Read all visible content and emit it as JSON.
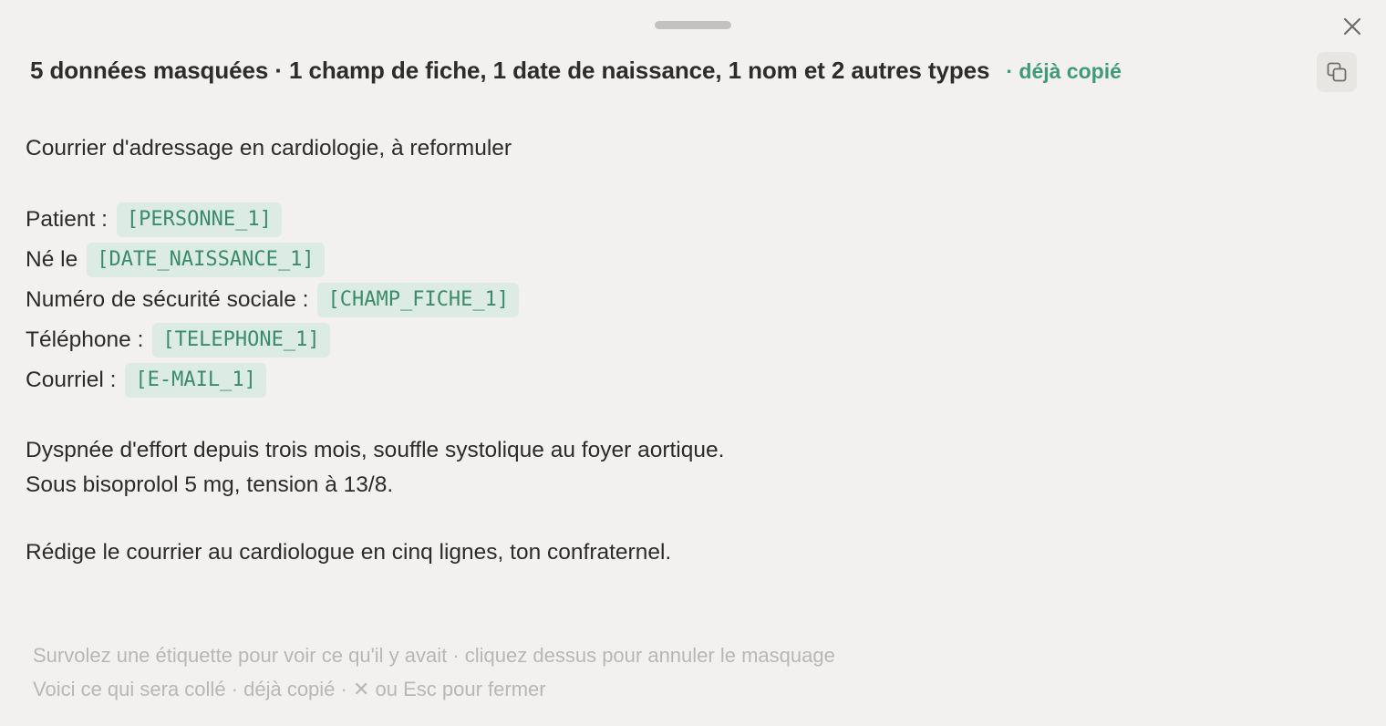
{
  "header": {
    "title": "5 données masquées · 1 champ de fiche, 1 date de naissance, 1 nom et 2 autres types",
    "status": "· déjà copié"
  },
  "icons": {
    "close": "close-icon",
    "copy": "copy-icon"
  },
  "colors": {
    "accent_green": "#3f9a78",
    "tag_background": "#dcece4",
    "background": "#f3f1ef"
  },
  "content": {
    "intro": "Courrier d'adressage en cardiologie, à reformuler",
    "fields": [
      {
        "label": "Patient :",
        "tag": "[PERSONNE_1]"
      },
      {
        "label": "Né le",
        "tag": "[DATE_NAISSANCE_1]"
      },
      {
        "label": "Numéro de sécurité sociale :",
        "tag": "[CHAMP_FICHE_1]"
      },
      {
        "label": "Téléphone :",
        "tag": "[TELEPHONE_1]"
      },
      {
        "label": "Courriel :",
        "tag": "[E-MAIL_1]"
      }
    ],
    "clinical_line_1": "Dyspnée d'effort depuis trois mois, souffle systolique au foyer aortique.",
    "clinical_line_2": "Sous bisoprolol 5 mg, tension à 13/8.",
    "instruction": "Rédige le courrier au cardiologue en cinq lignes, ton confraternel."
  },
  "footer": {
    "hint_1": "Survolez une étiquette pour voir ce qu'il y avait · cliquez dessus pour annuler le masquage",
    "hint_2": "Voici ce qui sera collé · déjà copié · ✕ ou Esc pour fermer"
  }
}
